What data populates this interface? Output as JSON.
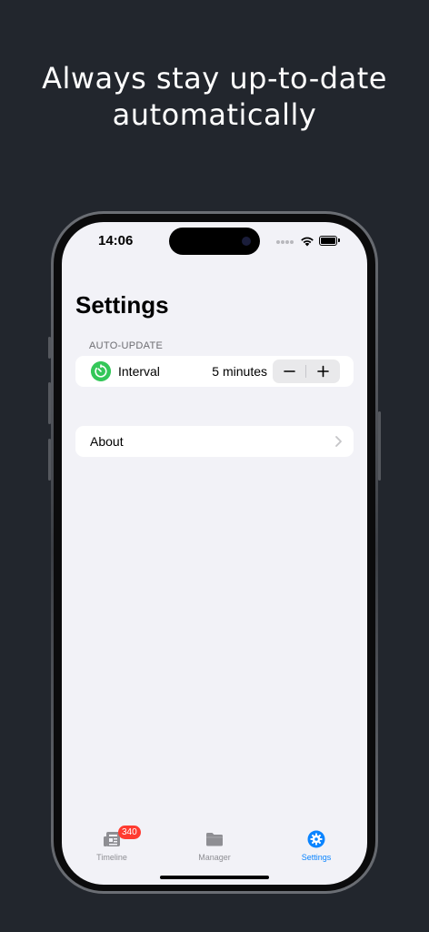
{
  "headline": {
    "line1": "Always stay up-to-date",
    "line2": "automatically"
  },
  "status_bar": {
    "time": "14:06"
  },
  "settings": {
    "title": "Settings",
    "auto_update": {
      "header": "AUTO-UPDATE",
      "interval_label": "Interval",
      "interval_value": "5 minutes",
      "stepper_minus": "−",
      "stepper_plus": "+",
      "icon": "timer-icon",
      "icon_color": "#34c759"
    },
    "about_label": "About"
  },
  "tab_bar": {
    "accent_color": "#0a84ff",
    "tabs": [
      {
        "label": "Timeline",
        "icon": "newspaper-icon",
        "badge": "340",
        "active": false
      },
      {
        "label": "Manager",
        "icon": "folder-icon",
        "active": false
      },
      {
        "label": "Settings",
        "icon": "gear-icon",
        "active": true
      }
    ]
  }
}
